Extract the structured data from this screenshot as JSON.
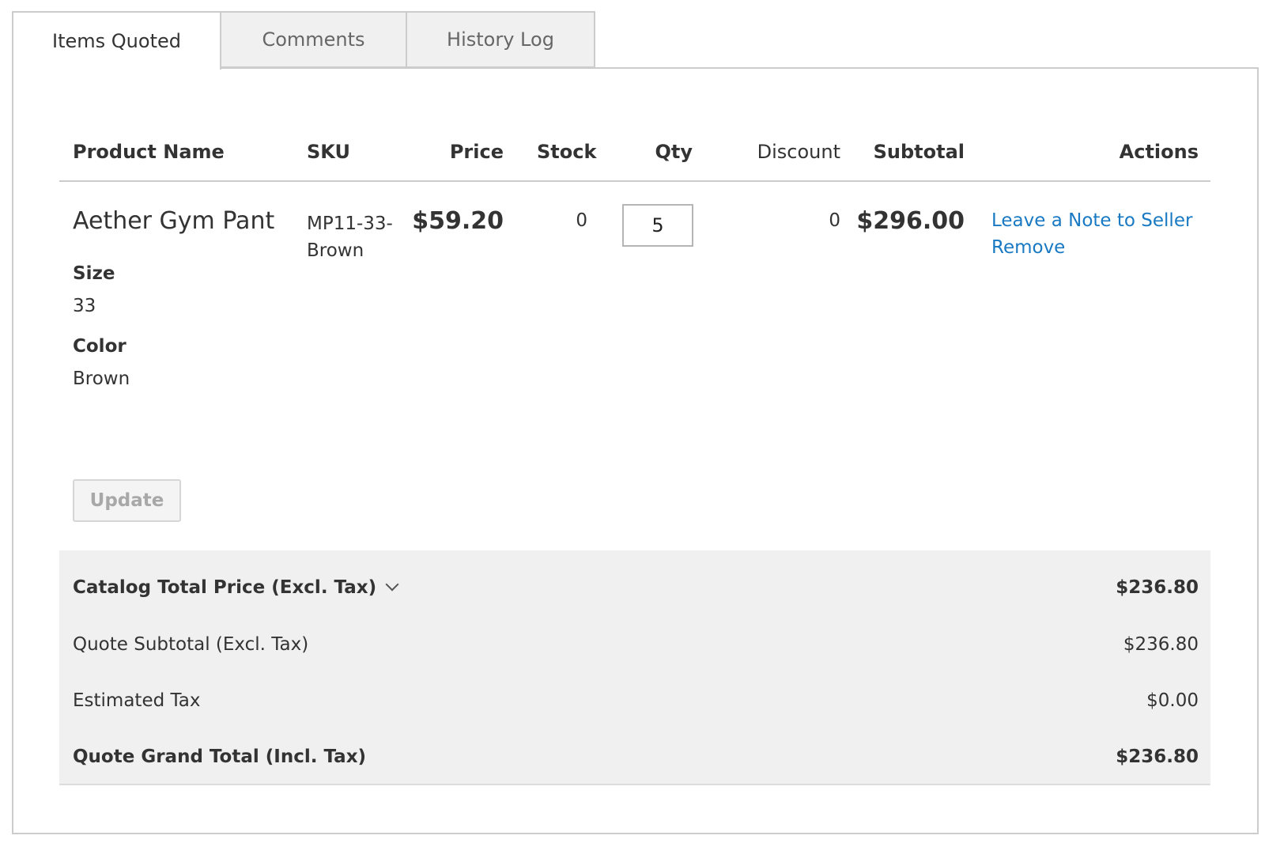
{
  "tabs": [
    {
      "label": "Items Quoted",
      "active": true
    },
    {
      "label": "Comments",
      "active": false
    },
    {
      "label": "History Log",
      "active": false
    }
  ],
  "table": {
    "headers": {
      "product_name": "Product Name",
      "sku": "SKU",
      "price": "Price",
      "stock": "Stock",
      "qty": "Qty",
      "discount": "Discount",
      "subtotal": "Subtotal",
      "actions": "Actions"
    },
    "rows": [
      {
        "product_name": "Aether Gym Pant",
        "options": [
          {
            "label": "Size",
            "value": "33"
          },
          {
            "label": "Color",
            "value": "Brown"
          }
        ],
        "sku_line1": "MP11-33-",
        "sku_line2": "Brown",
        "price": "$59.20",
        "stock": "0",
        "qty": "5",
        "discount": "0",
        "subtotal": "$296.00",
        "actions": {
          "note": "Leave a Note to Seller",
          "remove": "Remove"
        }
      }
    ]
  },
  "update_button": "Update",
  "totals": {
    "catalog_total": {
      "label": "Catalog Total Price (Excl. Tax)",
      "value": "$236.80"
    },
    "quote_subtotal": {
      "label": "Quote Subtotal (Excl. Tax)",
      "value": "$236.80"
    },
    "estimated_tax": {
      "label": "Estimated Tax",
      "value": "$0.00"
    },
    "grand_total": {
      "label": "Quote Grand Total (Incl. Tax)",
      "value": "$236.80"
    }
  },
  "colors": {
    "link": "#1979c3",
    "panel_border": "#cccccc",
    "totals_bg": "#f0f0f0"
  },
  "icons": {
    "catalog_toggle": "chevron-down-icon"
  }
}
